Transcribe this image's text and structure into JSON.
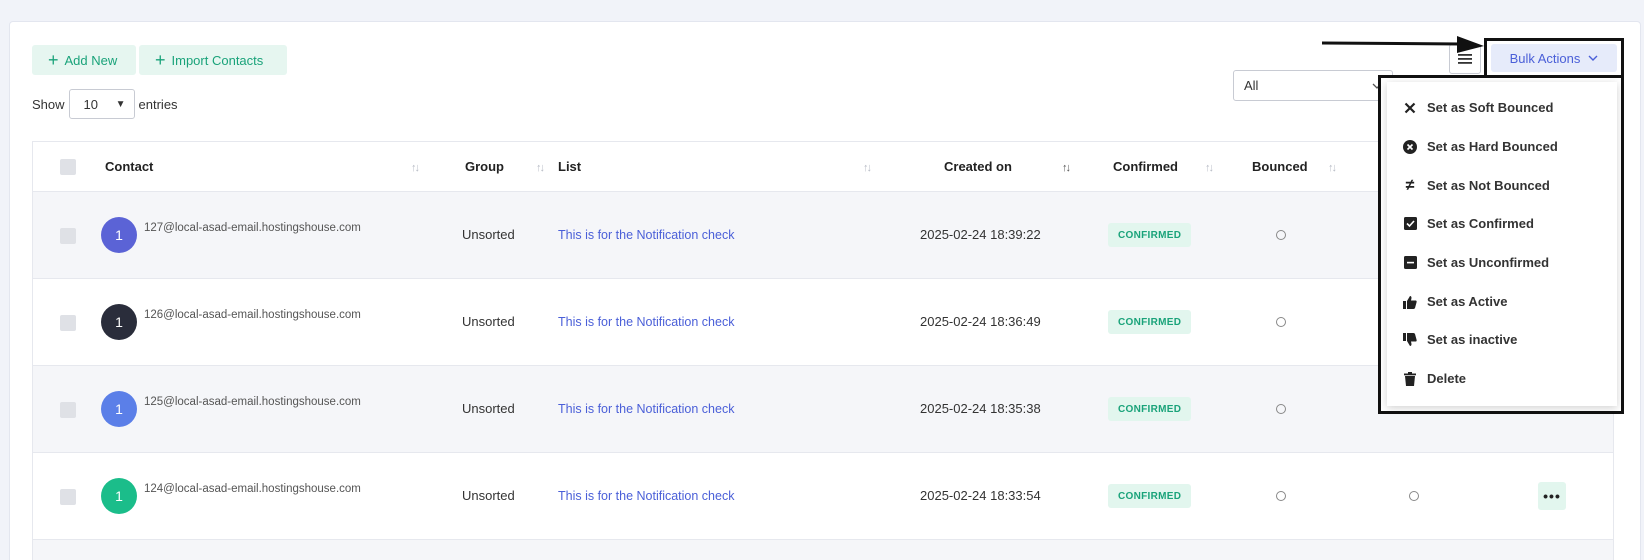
{
  "toolbar": {
    "add_new": "Add New",
    "import_contacts": "Import Contacts",
    "bulk_actions": "Bulk Actions"
  },
  "entries": {
    "show": "Show",
    "value": "10",
    "entries": "entries"
  },
  "filter": {
    "value": "All"
  },
  "columns": {
    "contact": "Contact",
    "group": "Group",
    "list": "List",
    "created_on": "Created on",
    "confirmed": "Confirmed",
    "bounced": "Bounced"
  },
  "rows": [
    {
      "avatar": "1",
      "avatar_color": "#5b63d6",
      "email": "127@local-asad-email.hostingshouse.com",
      "group": "Unsorted",
      "list": "This is for the Notification check",
      "created": "2025-02-24 18:39:22",
      "status": "CONFIRMED"
    },
    {
      "avatar": "1",
      "avatar_color": "#2a2d3b",
      "email": "126@local-asad-email.hostingshouse.com",
      "group": "Unsorted",
      "list": "This is for the Notification check",
      "created": "2025-02-24 18:36:49",
      "status": "CONFIRMED"
    },
    {
      "avatar": "1",
      "avatar_color": "#5b7fe8",
      "email": "125@local-asad-email.hostingshouse.com",
      "group": "Unsorted",
      "list": "This is for the Notification check",
      "created": "2025-02-24 18:35:38",
      "status": "CONFIRMED"
    },
    {
      "avatar": "1",
      "avatar_color": "#1bbd8a",
      "email": "124@local-asad-email.hostingshouse.com",
      "group": "Unsorted",
      "list": "This is for the Notification check",
      "created": "2025-02-24 18:33:54",
      "status": "CONFIRMED"
    }
  ],
  "dropdown": [
    {
      "label": "Set as Soft Bounced",
      "icon": "times-icon"
    },
    {
      "label": "Set as Hard Bounced",
      "icon": "circle-x-icon"
    },
    {
      "label": "Set as Not Bounced",
      "icon": "not-equal-icon"
    },
    {
      "label": "Set as Confirmed",
      "icon": "check-square-icon"
    },
    {
      "label": "Set as Unconfirmed",
      "icon": "minus-square-icon"
    },
    {
      "label": "Set as Active",
      "icon": "thumbs-up-icon"
    },
    {
      "label": "Set as inactive",
      "icon": "thumbs-down-icon"
    },
    {
      "label": "Delete",
      "icon": "trash-icon"
    }
  ]
}
